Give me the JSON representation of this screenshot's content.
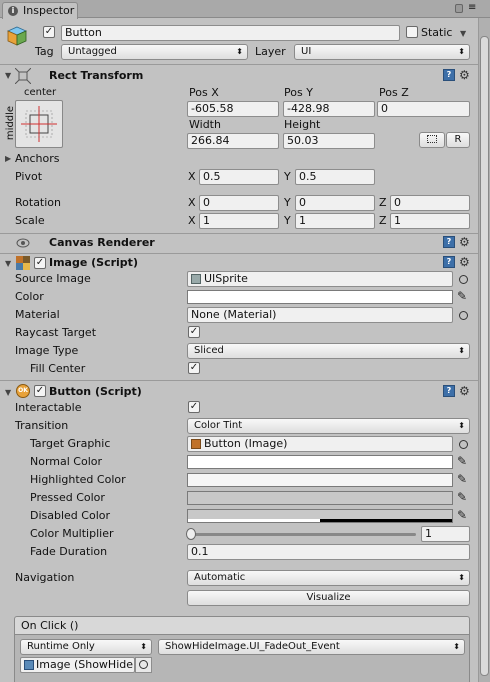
{
  "window": {
    "tab_label": "Inspector"
  },
  "object": {
    "name": "Button",
    "static_label": "Static",
    "tag_label": "Tag",
    "tag_value": "Untagged",
    "layer_label": "Layer",
    "layer_value": "UI"
  },
  "rect_transform": {
    "title": "Rect Transform",
    "anchor_preset_top": "center",
    "anchor_preset_side": "middle",
    "pos_x_label": "Pos X",
    "pos_y_label": "Pos Y",
    "pos_z_label": "Pos Z",
    "pos_x": "-605.58",
    "pos_y": "-428.98",
    "pos_z": "0",
    "width_label": "Width",
    "height_label": "Height",
    "width": "266.84",
    "height": "50.03",
    "reset_button": "R",
    "anchors_label": "Anchors",
    "pivot_label": "Pivot",
    "pivot_x": "0.5",
    "pivot_y": "0.5",
    "rotation_label": "Rotation",
    "rot_x": "0",
    "rot_y": "0",
    "rot_z": "0",
    "scale_label": "Scale",
    "scale_x": "1",
    "scale_y": "1",
    "scale_z": "1",
    "x": "X",
    "y": "Y",
    "z": "Z"
  },
  "canvas_renderer": {
    "title": "Canvas Renderer"
  },
  "image_script": {
    "title": "Image (Script)",
    "source_image_label": "Source Image",
    "source_image_value": "UISprite",
    "color_label": "Color",
    "color_value": "#ffffff",
    "material_label": "Material",
    "material_value": "None (Material)",
    "raycast_label": "Raycast Target",
    "image_type_label": "Image Type",
    "image_type_value": "Sliced",
    "fill_center_label": "Fill Center"
  },
  "button_script": {
    "title": "Button (Script)",
    "interactable_label": "Interactable",
    "transition_label": "Transition",
    "transition_value": "Color Tint",
    "target_graphic_label": "Target Graphic",
    "target_graphic_value": "Button (Image)",
    "normal_color_label": "Normal Color",
    "normal_color_value": "#ffffff",
    "highlighted_color_label": "Highlighted Color",
    "highlighted_color_value": "#f5f5f5",
    "pressed_color_label": "Pressed Color",
    "pressed_color_value": "#c8c8c8",
    "disabled_color_label": "Disabled Color",
    "disabled_color_value": "#c8c8c8",
    "color_multiplier_label": "Color Multiplier",
    "color_multiplier_value": "1",
    "fade_duration_label": "Fade Duration",
    "fade_duration_value": "0.1",
    "navigation_label": "Navigation",
    "navigation_value": "Automatic",
    "visualize_button": "Visualize"
  },
  "on_click": {
    "title": "On Click ()",
    "runtime_value": "Runtime Only",
    "function_value": "ShowHideImage.UI_FadeOut_Event",
    "object_value": "Image (ShowHide"
  },
  "icons": {
    "check": "✓",
    "help": "?",
    "gear": "⚙",
    "dropdown_arrow": "▾",
    "tri_down": "▼",
    "tri_right": "▶",
    "eyedropper": "✎"
  },
  "colors": {
    "panel": "#c2c2c2",
    "accent": "#3d6fa8"
  }
}
